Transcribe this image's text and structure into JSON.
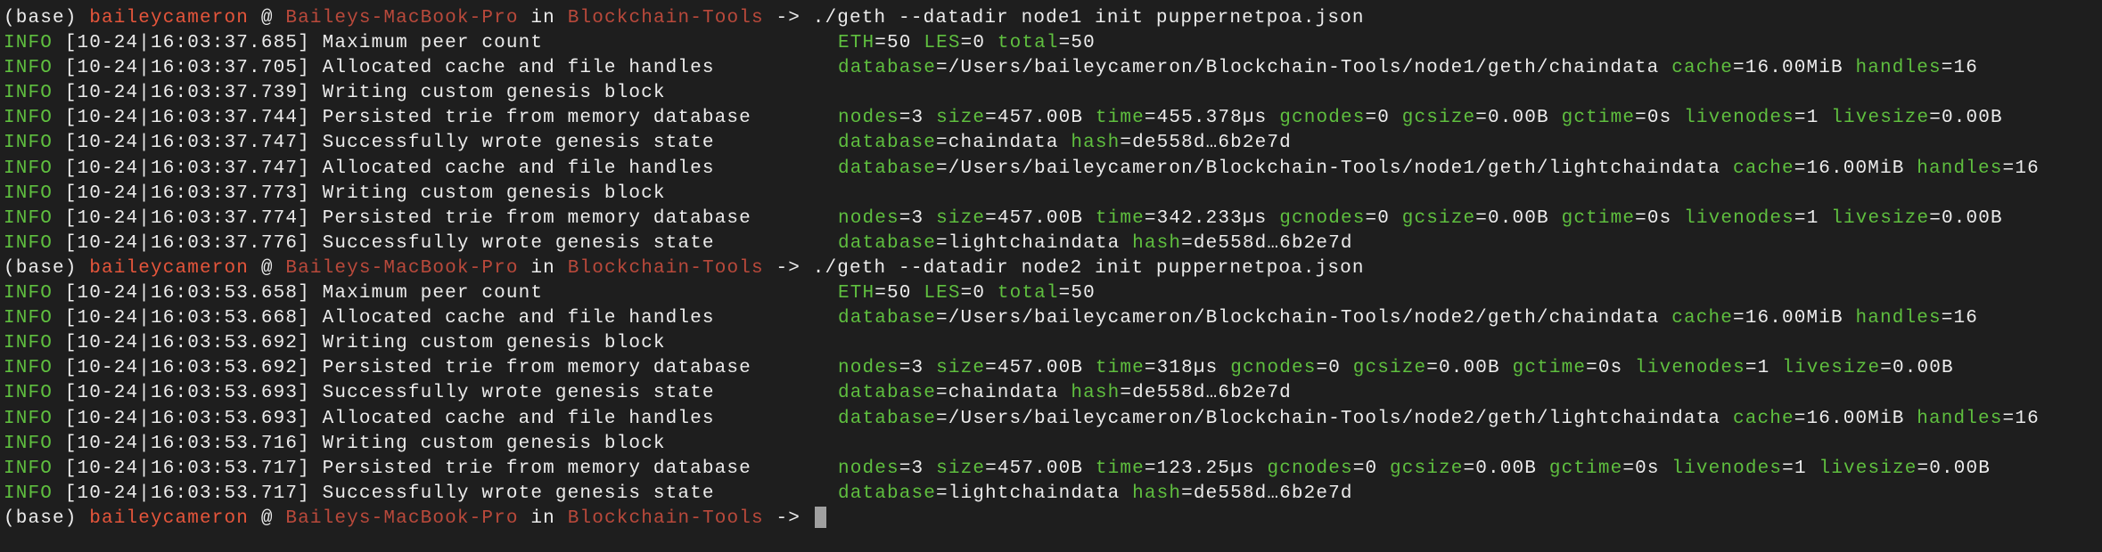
{
  "prompt": {
    "env": "(base)",
    "user": "baileycameron",
    "at": "@",
    "host": "Baileys-MacBook-Pro",
    "in": "in",
    "dir": "Blockchain-Tools",
    "arrow": "->"
  },
  "colors": {
    "background": "#1e1e1e",
    "text": "#ececec",
    "key_green": "#5fbf3f",
    "user": "#e5553b",
    "host": "#b9493b",
    "cursor": "#a0a0a0"
  },
  "lines": [
    {
      "type": "prompt",
      "command": "./geth --datadir node1 init puppernetpoa.json"
    },
    {
      "type": "log",
      "level": "INFO",
      "ts": "[10-24|16:03:37.685]",
      "msg": "Maximum peer count",
      "ctx": [
        {
          "k": "ETH",
          "v": "50"
        },
        {
          "k": "LES",
          "v": "0"
        },
        {
          "k": "total",
          "v": "50"
        }
      ]
    },
    {
      "type": "log",
      "level": "INFO",
      "ts": "[10-24|16:03:37.705]",
      "msg": "Allocated cache and file handles",
      "ctx": [
        {
          "k": "database",
          "v": "/Users/baileycameron/Blockchain-Tools/node1/geth/chaindata"
        },
        {
          "k": "cache",
          "v": "16.00MiB"
        },
        {
          "k": "handles",
          "v": "16"
        }
      ]
    },
    {
      "type": "log",
      "level": "INFO",
      "ts": "[10-24|16:03:37.739]",
      "msg": "Writing custom genesis block",
      "ctx": []
    },
    {
      "type": "log",
      "level": "INFO",
      "ts": "[10-24|16:03:37.744]",
      "msg": "Persisted trie from memory database",
      "ctx": [
        {
          "k": "nodes",
          "v": "3"
        },
        {
          "k": "size",
          "v": "457.00B"
        },
        {
          "k": "time",
          "v": "455.378µs"
        },
        {
          "k": "gcnodes",
          "v": "0"
        },
        {
          "k": "gcsize",
          "v": "0.00B"
        },
        {
          "k": "gctime",
          "v": "0s"
        },
        {
          "k": "livenodes",
          "v": "1"
        },
        {
          "k": "livesize",
          "v": "0.00B"
        }
      ]
    },
    {
      "type": "log",
      "level": "INFO",
      "ts": "[10-24|16:03:37.747]",
      "msg": "Successfully wrote genesis state",
      "ctx": [
        {
          "k": "database",
          "v": "chaindata"
        },
        {
          "k": "hash",
          "v": "de558d…6b2e7d"
        }
      ]
    },
    {
      "type": "log",
      "level": "INFO",
      "ts": "[10-24|16:03:37.747]",
      "msg": "Allocated cache and file handles",
      "ctx": [
        {
          "k": "database",
          "v": "/Users/baileycameron/Blockchain-Tools/node1/geth/lightchaindata"
        },
        {
          "k": "cache",
          "v": "16.00MiB"
        },
        {
          "k": "handles",
          "v": "16"
        }
      ]
    },
    {
      "type": "log",
      "level": "INFO",
      "ts": "[10-24|16:03:37.773]",
      "msg": "Writing custom genesis block",
      "ctx": []
    },
    {
      "type": "log",
      "level": "INFO",
      "ts": "[10-24|16:03:37.774]",
      "msg": "Persisted trie from memory database",
      "ctx": [
        {
          "k": "nodes",
          "v": "3"
        },
        {
          "k": "size",
          "v": "457.00B"
        },
        {
          "k": "time",
          "v": "342.233µs"
        },
        {
          "k": "gcnodes",
          "v": "0"
        },
        {
          "k": "gcsize",
          "v": "0.00B"
        },
        {
          "k": "gctime",
          "v": "0s"
        },
        {
          "k": "livenodes",
          "v": "1"
        },
        {
          "k": "livesize",
          "v": "0.00B"
        }
      ]
    },
    {
      "type": "log",
      "level": "INFO",
      "ts": "[10-24|16:03:37.776]",
      "msg": "Successfully wrote genesis state",
      "ctx": [
        {
          "k": "database",
          "v": "lightchaindata"
        },
        {
          "k": "hash",
          "v": "de558d…6b2e7d"
        }
      ]
    },
    {
      "type": "prompt",
      "command": "./geth --datadir node2 init puppernetpoa.json"
    },
    {
      "type": "log",
      "level": "INFO",
      "ts": "[10-24|16:03:53.658]",
      "msg": "Maximum peer count",
      "ctx": [
        {
          "k": "ETH",
          "v": "50"
        },
        {
          "k": "LES",
          "v": "0"
        },
        {
          "k": "total",
          "v": "50"
        }
      ]
    },
    {
      "type": "log",
      "level": "INFO",
      "ts": "[10-24|16:03:53.668]",
      "msg": "Allocated cache and file handles",
      "ctx": [
        {
          "k": "database",
          "v": "/Users/baileycameron/Blockchain-Tools/node2/geth/chaindata"
        },
        {
          "k": "cache",
          "v": "16.00MiB"
        },
        {
          "k": "handles",
          "v": "16"
        }
      ]
    },
    {
      "type": "log",
      "level": "INFO",
      "ts": "[10-24|16:03:53.692]",
      "msg": "Writing custom genesis block",
      "ctx": []
    },
    {
      "type": "log",
      "level": "INFO",
      "ts": "[10-24|16:03:53.692]",
      "msg": "Persisted trie from memory database",
      "ctx": [
        {
          "k": "nodes",
          "v": "3"
        },
        {
          "k": "size",
          "v": "457.00B"
        },
        {
          "k": "time",
          "v": "318µs"
        },
        {
          "k": "gcnodes",
          "v": "0"
        },
        {
          "k": "gcsize",
          "v": "0.00B"
        },
        {
          "k": "gctime",
          "v": "0s"
        },
        {
          "k": "livenodes",
          "v": "1"
        },
        {
          "k": "livesize",
          "v": "0.00B"
        }
      ]
    },
    {
      "type": "log",
      "level": "INFO",
      "ts": "[10-24|16:03:53.693]",
      "msg": "Successfully wrote genesis state",
      "ctx": [
        {
          "k": "database",
          "v": "chaindata"
        },
        {
          "k": "hash",
          "v": "de558d…6b2e7d"
        }
      ]
    },
    {
      "type": "log",
      "level": "INFO",
      "ts": "[10-24|16:03:53.693]",
      "msg": "Allocated cache and file handles",
      "ctx": [
        {
          "k": "database",
          "v": "/Users/baileycameron/Blockchain-Tools/node2/geth/lightchaindata"
        },
        {
          "k": "cache",
          "v": "16.00MiB"
        },
        {
          "k": "handles",
          "v": "16"
        }
      ]
    },
    {
      "type": "log",
      "level": "INFO",
      "ts": "[10-24|16:03:53.716]",
      "msg": "Writing custom genesis block",
      "ctx": []
    },
    {
      "type": "log",
      "level": "INFO",
      "ts": "[10-24|16:03:53.717]",
      "msg": "Persisted trie from memory database",
      "ctx": [
        {
          "k": "nodes",
          "v": "3"
        },
        {
          "k": "size",
          "v": "457.00B"
        },
        {
          "k": "time",
          "v": "123.25µs"
        },
        {
          "k": "gcnodes",
          "v": "0"
        },
        {
          "k": "gcsize",
          "v": "0.00B"
        },
        {
          "k": "gctime",
          "v": "0s"
        },
        {
          "k": "livenodes",
          "v": "1"
        },
        {
          "k": "livesize",
          "v": "0.00B"
        }
      ]
    },
    {
      "type": "log",
      "level": "INFO",
      "ts": "[10-24|16:03:53.717]",
      "msg": "Successfully wrote genesis state",
      "ctx": [
        {
          "k": "database",
          "v": "lightchaindata"
        },
        {
          "k": "hash",
          "v": "de558d…6b2e7d"
        }
      ]
    },
    {
      "type": "prompt",
      "command": "",
      "cursor": true
    }
  ]
}
